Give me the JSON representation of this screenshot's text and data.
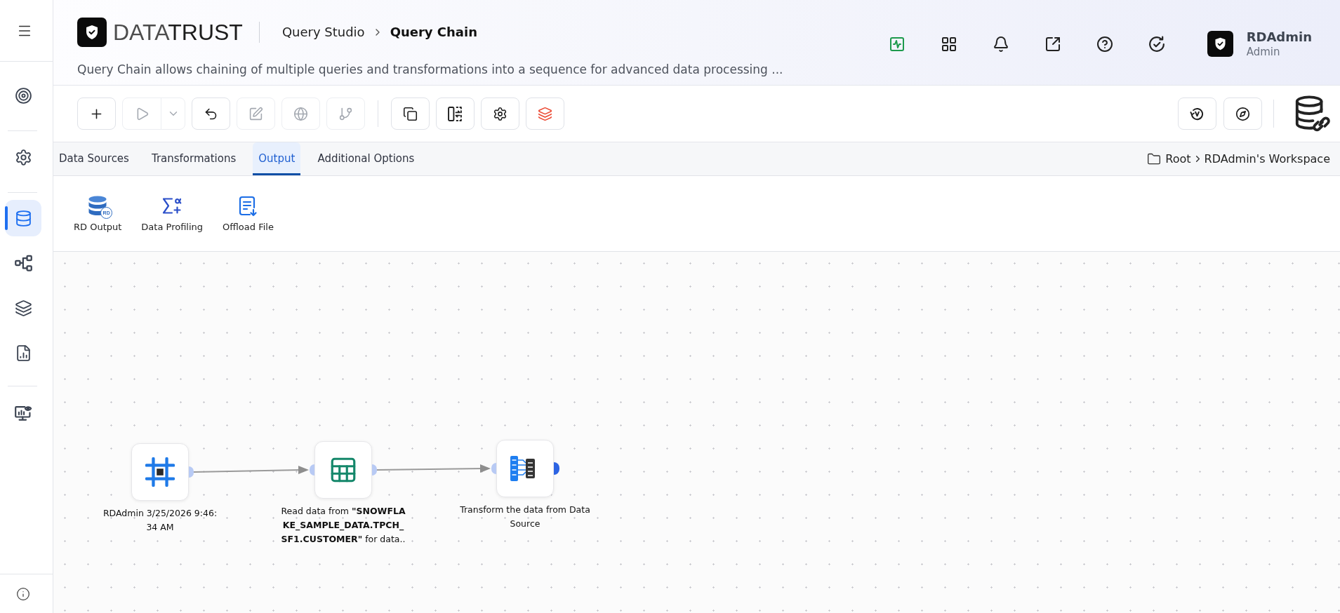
{
  "sidebar": {
    "groups": [
      [
        {
          "selected": false
        }
      ],
      [
        {
          "selected": false
        }
      ],
      [
        {
          "selected": true
        },
        {
          "selected": false
        },
        {
          "selected": false
        },
        {
          "selected": false
        }
      ],
      [
        {
          "selected": false
        }
      ]
    ]
  },
  "header": {
    "brand": {
      "light": "DATA",
      "dark": "TRUST"
    },
    "breadcrumb": [
      {
        "label": "Query Studio",
        "current": false
      },
      {
        "label": "Query Chain",
        "current": true
      }
    ],
    "description": "Query Chain allows chaining of multiple queries and transformations into a sequence for advanced data processing ...",
    "user": {
      "name": "RDAdmin",
      "role": "Admin"
    }
  },
  "toolbar": {
    "buttons": [
      {
        "disabled": false
      },
      {
        "disabled": true
      },
      {
        "disabled": true
      },
      {
        "disabled": false
      },
      {
        "disabled": true
      },
      {
        "disabled": true
      },
      {
        "disabled": true
      },
      {
        "disabled": false
      },
      {
        "disabled": false
      },
      {
        "disabled": false
      },
      {
        "disabled": false
      }
    ],
    "right_buttons": [
      {
        "disabled": false
      },
      {
        "disabled": false
      }
    ]
  },
  "tabs": [
    {
      "label": "Data Sources",
      "selected": false
    },
    {
      "label": "Transformations",
      "selected": false
    },
    {
      "label": "Output",
      "selected": true
    },
    {
      "label": "Additional Options",
      "selected": false
    }
  ],
  "workspace_path": [
    "Root",
    "RDAdmin's Workspace"
  ],
  "output_tools": [
    {
      "label": "RD Output",
      "badge": "RD"
    },
    {
      "label": "Data Profiling"
    },
    {
      "label": "Offload File"
    }
  ],
  "canvas": {
    "nodes": [
      {
        "kind": "source",
        "label": "RDAdmin 3/25/2026 9:46:34 AM"
      },
      {
        "kind": "read",
        "label": "Read data from **\"SNOWFLAKE_SAMPLE_DATA.TPCH_SF1.CUSTOMER\"** for data.."
      },
      {
        "kind": "transform",
        "label": "Transform the data from Data Source"
      }
    ]
  }
}
